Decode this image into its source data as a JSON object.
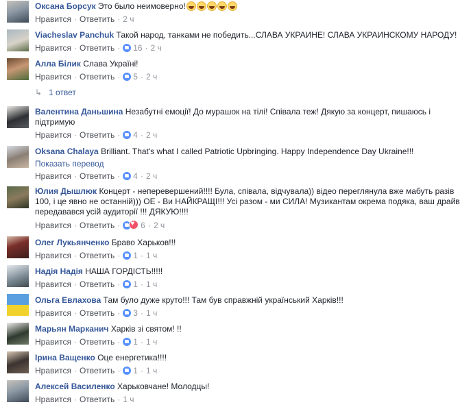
{
  "labels": {
    "like": "Нравится",
    "reply": "Ответить",
    "translate": "Показать перевод",
    "sep": "·"
  },
  "comments": [
    {
      "name": "Оксана Борсук",
      "text": "Это было неимоверно!",
      "emoji_count": 5,
      "likes": "",
      "time": "2 ч",
      "avatar_icon": "user-avatar-photo"
    },
    {
      "name": "Viacheslav Panchuk",
      "text": "Такой народ, танками не победить...СЛАВА УКРАИНЕ! СЛАВА УКРАИНСКОМУ НАРОДУ!",
      "likes": "16",
      "time": "2 ч",
      "avatar_icon": "user-avatar-photo"
    },
    {
      "name": "Алла Білик",
      "text": "Слава Україні!",
      "likes": "5",
      "time": "2 ч",
      "avatar_icon": "user-avatar-photo"
    },
    {
      "name": "Валентина Даньшина",
      "text": "Незабутні емоції! До мурашок на тілі! Співала теж! Дякую за концерт, пишаюсь і підтримую",
      "likes": "4",
      "time": "2 ч",
      "avatar_icon": "user-avatar-photo"
    },
    {
      "name": "Oksana Chalaya",
      "text": "Brilliant. That's what I called Patriotic Upbringing. Happy Independence Day Ukraine!!!",
      "likes": "4",
      "time": "2 ч",
      "avatar_icon": "user-avatar-photo"
    },
    {
      "name": "Юлия Дышлюк",
      "text": "Концерт - неперевершений!!!! Була, співала, відчувала)) відео переглянула вже мабуть разів 100, і це явно не останній))) ОЕ - Ви НАЙКРАЩІ!!! Усі разом - ми СИЛА! Музикантам окрема подяка, ваш драйв передавався усій аудиторії !!! ДЯКУЮ!!!!",
      "likes": "6",
      "time": "2 ч",
      "avatar_icon": "user-avatar-photo"
    },
    {
      "name": "Олег Лукьянченко",
      "text": "Браво Харьков!!!",
      "likes": "1",
      "time": "1 ч",
      "avatar_icon": "user-avatar-photo"
    },
    {
      "name": "Надія Надія",
      "text": "НАША ГОРДІСТЬ!!!!!",
      "likes": "1",
      "time": "1 ч",
      "avatar_icon": "user-avatar-photo"
    },
    {
      "name": "Ольга Евлахова",
      "text": "Там було дуже круто!!! Там був справжній український Харків!!!",
      "likes": "3",
      "time": "1 ч",
      "avatar_icon": "user-avatar-photo"
    },
    {
      "name": "Марьян Марканич",
      "text": "Харків зі святом! !!",
      "likes": "1",
      "time": "1 ч",
      "avatar_icon": "user-avatar-photo"
    },
    {
      "name": "Ірина Ващенко",
      "text": "Оце енергетика!!!!",
      "likes": "1",
      "time": "1 ч",
      "avatar_icon": "user-avatar-photo"
    },
    {
      "name": "Алексей Василенко",
      "text": "Харьковчане! Молодцы!",
      "likes": "",
      "time": "1 ч",
      "avatar_icon": "user-avatar-photo"
    }
  ],
  "replies_link": "1 ответ"
}
